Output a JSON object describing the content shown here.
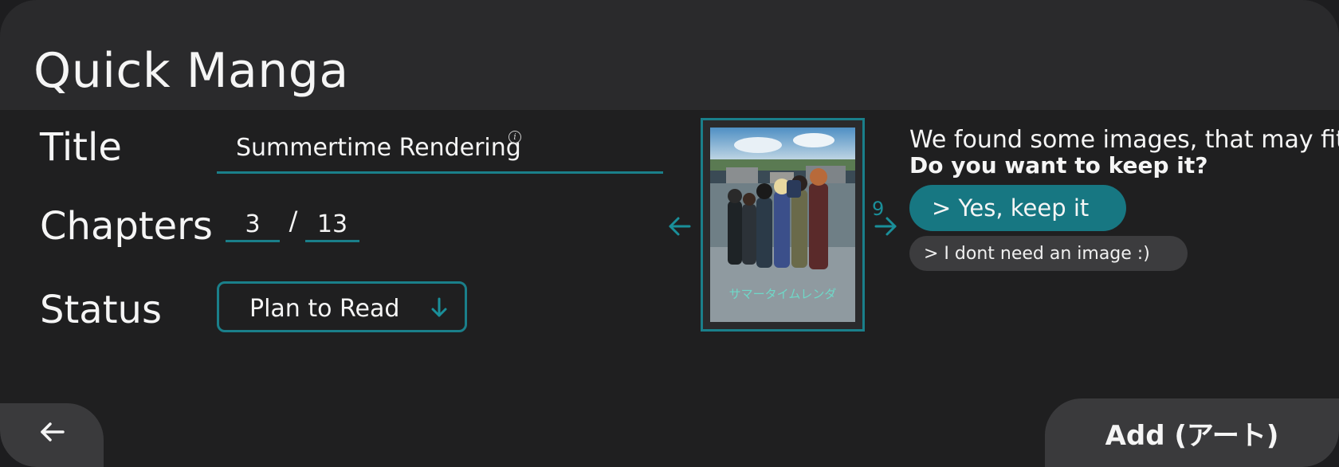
{
  "app": {
    "title": "Quick Manga"
  },
  "form": {
    "title_label": "Title",
    "title_value": "Summertime Rendering",
    "chapters_label": "Chapters",
    "chapters_read": "3",
    "chapters_separator": "/",
    "chapters_total": "13",
    "status_label": "Status",
    "status_value": "Plan to Read"
  },
  "image_suggestion": {
    "image_count": "9",
    "message": "We found some images, that may fit.",
    "question": "Do you want to keep it?",
    "keep_label": "> Yes, keep it",
    "skip_label": "> I dont need an image :)",
    "cover_overlay_text": "サマータイムレンダ"
  },
  "footer": {
    "add_label": "Add (アート)"
  },
  "icons": {
    "info": "info-icon",
    "dropdown": "arrow-down-icon",
    "prev": "arrow-left-icon",
    "next": "arrow-right-icon",
    "back": "arrow-left-icon"
  },
  "colors": {
    "accent": "#1a7f8a",
    "accent_fill": "#177782",
    "background": "#1f1f20",
    "header": "#2a2a2c",
    "button_secondary": "#3a3a3c"
  }
}
